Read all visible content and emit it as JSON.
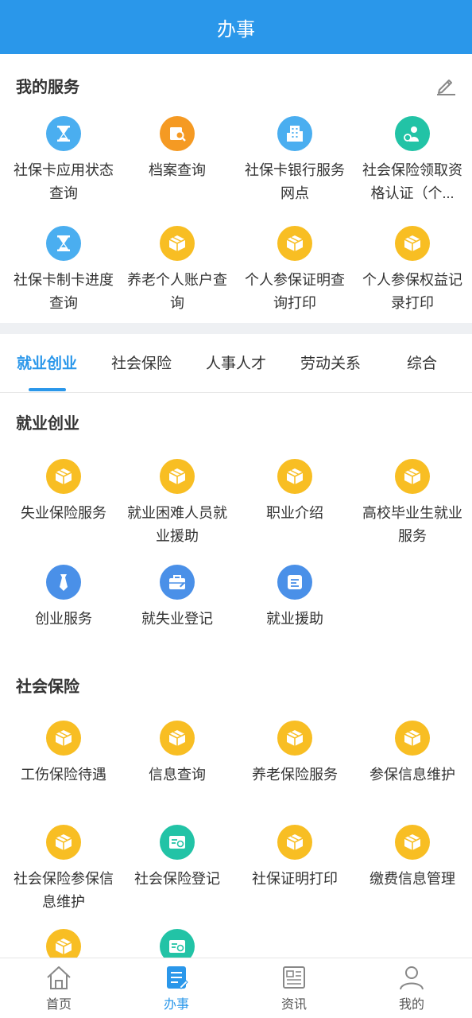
{
  "header": {
    "title": "办事"
  },
  "my_services": {
    "title": "我的服务",
    "items": [
      {
        "label": "社保卡应用状态查询",
        "icon": "hourglass-icon",
        "color": "#4aaef0"
      },
      {
        "label": "档案查询",
        "icon": "search-doc-icon",
        "color": "#f59a23"
      },
      {
        "label": "社保卡银行服务网点",
        "icon": "building-icon",
        "color": "#4aaef0"
      },
      {
        "label": "社会保险领取资格认证（个...",
        "icon": "person-icon",
        "color": "#22c3a6"
      },
      {
        "label": "社保卡制卡进度查询",
        "icon": "hourglass-icon",
        "color": "#4aaef0"
      },
      {
        "label": "养老个人账户查询",
        "icon": "box-icon",
        "color": "#f8be23"
      },
      {
        "label": "个人参保证明查询打印",
        "icon": "box-icon",
        "color": "#f8be23"
      },
      {
        "label": "个人参保权益记录打印",
        "icon": "box-icon",
        "color": "#f8be23"
      }
    ]
  },
  "tabs": [
    "就业创业",
    "社会保险",
    "人事人才",
    "劳动关系",
    "综合"
  ],
  "employment": {
    "title": "就业创业",
    "items": [
      {
        "label": "失业保险服务",
        "icon": "box-icon",
        "color": "#f8be23"
      },
      {
        "label": "就业困难人员就业援助",
        "icon": "box-icon",
        "color": "#f8be23"
      },
      {
        "label": "职业介绍",
        "icon": "box-icon",
        "color": "#f8be23"
      },
      {
        "label": "高校毕业生就业服务",
        "icon": "box-icon",
        "color": "#f8be23"
      },
      {
        "label": "创业服务",
        "icon": "tie-icon",
        "color": "#4a90e8"
      },
      {
        "label": "就失业登记",
        "icon": "briefcase-icon",
        "color": "#4a90e8"
      },
      {
        "label": "就业援助",
        "icon": "note-icon",
        "color": "#4a90e8"
      }
    ]
  },
  "social_insurance": {
    "title": "社会保险",
    "items": [
      {
        "label": "工伤保险待遇",
        "icon": "box-icon",
        "color": "#f8be23"
      },
      {
        "label": "信息查询",
        "icon": "box-icon",
        "color": "#f8be23"
      },
      {
        "label": "养老保险服务",
        "icon": "box-icon",
        "color": "#f8be23"
      },
      {
        "label": "参保信息维护",
        "icon": "box-icon",
        "color": "#f8be23"
      },
      {
        "label": "社会保险参保信息维护",
        "icon": "box-icon",
        "color": "#f8be23"
      },
      {
        "label": "社会保险登记",
        "icon": "card-icon",
        "color": "#22c3a6"
      },
      {
        "label": "社保证明打印",
        "icon": "box-icon",
        "color": "#f8be23"
      },
      {
        "label": "缴费信息管理",
        "icon": "box-icon",
        "color": "#f8be23"
      },
      {
        "label": "",
        "icon": "box-icon",
        "color": "#f8be23"
      },
      {
        "label": "",
        "icon": "card-icon",
        "color": "#22c3a6"
      }
    ]
  },
  "bottom_nav": [
    {
      "label": "首页",
      "icon": "home-icon"
    },
    {
      "label": "办事",
      "icon": "tasks-icon"
    },
    {
      "label": "资讯",
      "icon": "news-icon"
    },
    {
      "label": "我的",
      "icon": "user-icon"
    }
  ],
  "colors": {
    "primary": "#2a97ea",
    "separator": "#eef0f3"
  }
}
